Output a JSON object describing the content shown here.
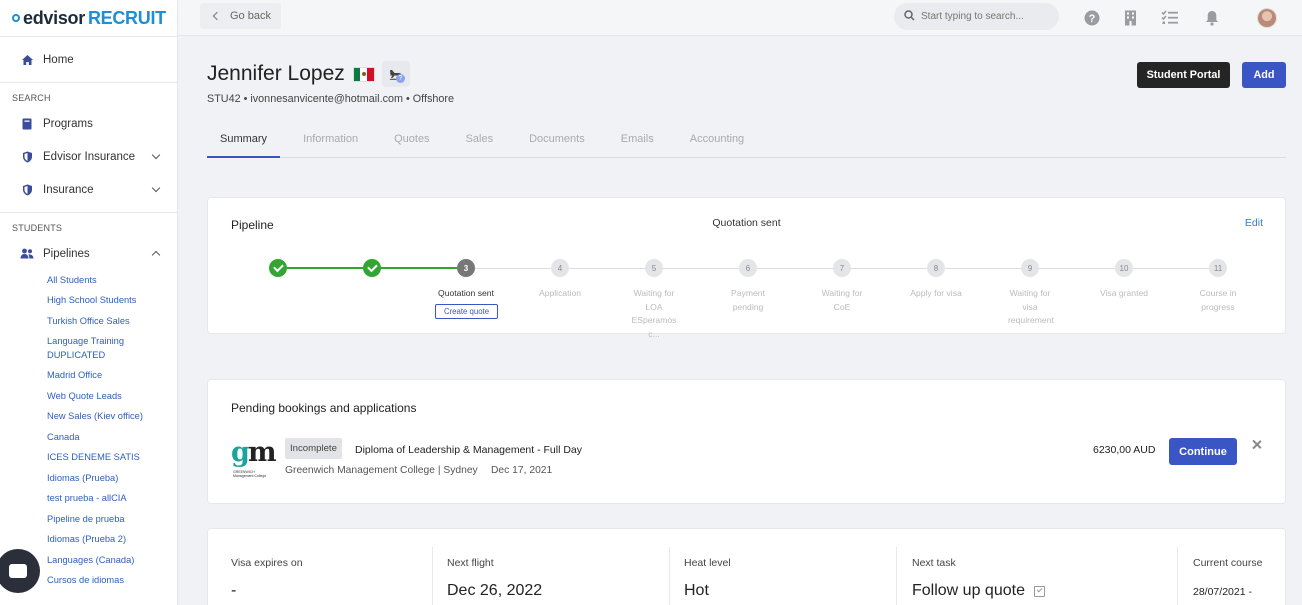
{
  "app": {
    "logo_main": "edvisor",
    "logo_accent": "RECRUIT"
  },
  "topbar": {
    "goback_label": "Go back",
    "search_placeholder": "Start typing to search..."
  },
  "sidebar": {
    "home": "Home",
    "search_section": "SEARCH",
    "search_items": [
      {
        "label": "Programs",
        "icon": "book-icon"
      },
      {
        "label": "Edvisor Insurance",
        "icon": "shield-icon"
      },
      {
        "label": "Insurance",
        "icon": "shield-icon"
      }
    ],
    "students_section": "STUDENTS",
    "pipelines_label": "Pipelines",
    "pipelines": [
      "All Students",
      "High School Students",
      "Turkish Office Sales",
      "Language Training DUPLICATED",
      "Madrid Office",
      "Web Quote Leads",
      "New Sales (Kiev office)",
      "Canada",
      "ICES DENEME SATIS",
      "Idiomas (Prueba)",
      "test prueba - allCIA",
      "Pipeline de prueba",
      "Idiomas (Prueba 2)",
      "Languages (Canada)",
      "Cursos de idiomas"
    ]
  },
  "student": {
    "name": "Jennifer Lopez",
    "meta": "STU42 • ivonnesanvicente@hotmail.com • Offshore",
    "flag_colors": [
      "#0b7a3e",
      "#ffffff",
      "#ce1126"
    ]
  },
  "actions": {
    "student_portal": "Student Portal",
    "add": "Add"
  },
  "tabs": [
    "Summary",
    "Information",
    "Quotes",
    "Sales",
    "Documents",
    "Emails",
    "Accounting"
  ],
  "pipeline": {
    "title": "Pipeline",
    "status": "Quotation sent",
    "edit": "Edit",
    "create_quote": "Create quote",
    "steps": [
      {
        "num": "1",
        "state": "done",
        "label": ""
      },
      {
        "num": "2",
        "state": "done",
        "label": ""
      },
      {
        "num": "3",
        "state": "current",
        "label": "Quotation sent"
      },
      {
        "num": "4",
        "state": "pending",
        "label": "Application"
      },
      {
        "num": "5",
        "state": "pending",
        "label": "Waiting for LOA ESperamos c..."
      },
      {
        "num": "6",
        "state": "pending",
        "label": "Payment pending"
      },
      {
        "num": "7",
        "state": "pending",
        "label": "Waiting for CoE"
      },
      {
        "num": "8",
        "state": "pending",
        "label": "Apply for visa"
      },
      {
        "num": "9",
        "state": "pending",
        "label": "Waiting for visa requirement"
      },
      {
        "num": "10",
        "state": "pending",
        "label": "Visa granted"
      },
      {
        "num": "11",
        "state": "pending",
        "label": "Course in progress"
      }
    ]
  },
  "bookings": {
    "title": "Pending bookings and applications",
    "logo_g": "g",
    "logo_m": "m",
    "logo_sub": "GREENWICH Management College",
    "status_badge": "Incomplete",
    "course": "Diploma of Leadership & Management - Full Day",
    "school": "Greenwich Management College | Sydney",
    "date": "Dec 17, 2021",
    "price": "6230,00 AUD",
    "continue": "Continue"
  },
  "info": [
    {
      "label": "Visa expires on",
      "value": "-"
    },
    {
      "label": "Next flight",
      "value": "Dec 26, 2022"
    },
    {
      "label": "Heat level",
      "value": "Hot"
    },
    {
      "label": "Next task",
      "value": "Follow up quote"
    },
    {
      "label": "Current course",
      "value": "28/07/2021 -"
    }
  ],
  "colors": {
    "accent": "#3a56c4",
    "done": "#33a532",
    "link": "#2f7fc8"
  }
}
